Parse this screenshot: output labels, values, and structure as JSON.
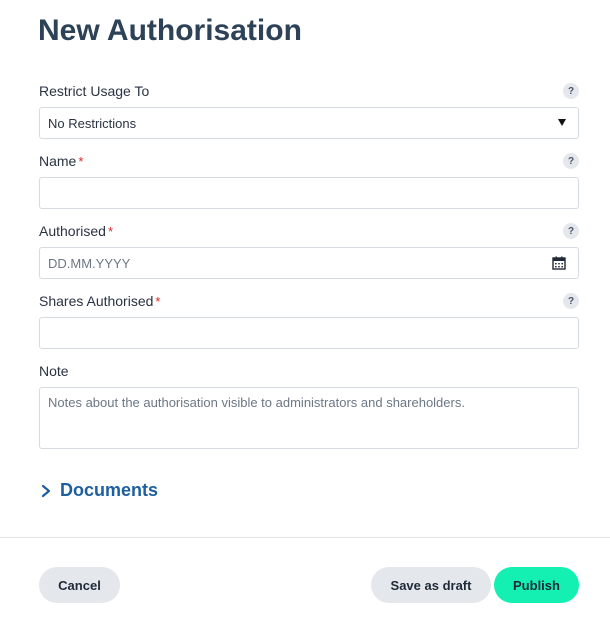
{
  "page_title": "New Authorisation",
  "fields": {
    "restrict_usage": {
      "label": "Restrict Usage To",
      "help": "?",
      "selected_value": "No Restrictions"
    },
    "name": {
      "label": "Name",
      "required_mark": "*",
      "help": "?",
      "value": ""
    },
    "authorised": {
      "label": "Authorised",
      "required_mark": "*",
      "help": "?",
      "placeholder": "DD.MM.YYYY",
      "icon": "calendar-icon"
    },
    "shares_authorised": {
      "label": "Shares Authorised",
      "required_mark": "*",
      "help": "?",
      "value": ""
    },
    "note": {
      "label": "Note",
      "placeholder": "Notes about the authorisation visible to administrators and shareholders."
    }
  },
  "documents": {
    "label": "Documents",
    "icon": "chevron-right-icon"
  },
  "footer": {
    "cancel_label": "Cancel",
    "draft_label": "Save as draft",
    "publish_label": "Publish"
  },
  "colors": {
    "title": "#2d4157",
    "link": "#1e5fa0",
    "required": "#e02424",
    "publish_bg": "#13f0b2",
    "secondary_bg": "#e4e7eb"
  }
}
